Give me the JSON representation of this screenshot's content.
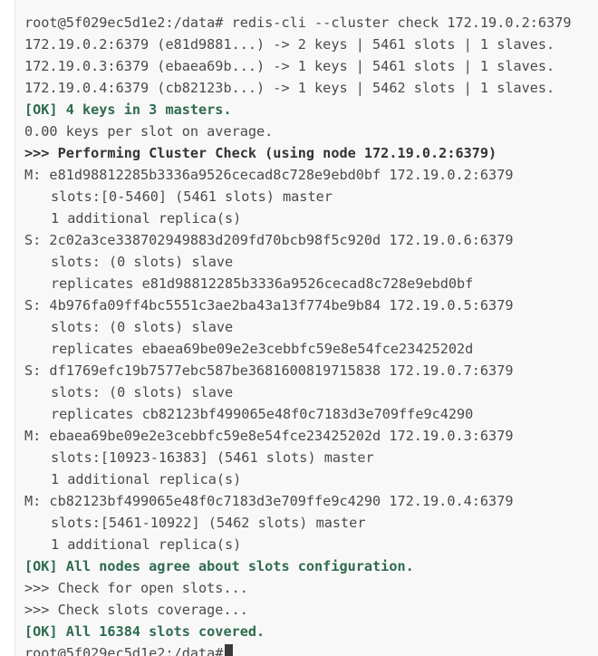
{
  "terminal": {
    "lines": [
      "root@5f029ec5d1e2:/data# redis-cli --cluster check 172.19.0.2:6379",
      "172.19.0.2:6379 (e81d9881...) -> 2 keys | 5461 slots | 1 slaves.",
      "172.19.0.3:6379 (ebaea69b...) -> 1 keys | 5461 slots | 1 slaves.",
      "172.19.0.4:6379 (cb82123b...) -> 1 keys | 5462 slots | 1 slaves.",
      "[OK] 4 keys in 3 masters.",
      "0.00 keys per slot on average.",
      ">>> Performing Cluster Check (using node 172.19.0.2:6379)",
      "M: e81d98812285b3336a9526cecad8c728e9ebd0bf 172.19.0.2:6379",
      "slots:[0-5460] (5461 slots) master",
      "1 additional replica(s)",
      "S: 2c02a3ce338702949883d209fd70bcb98f5c920d 172.19.0.6:6379",
      "slots: (0 slots) slave",
      "replicates e81d98812285b3336a9526cecad8c728e9ebd0bf",
      "S: 4b976fa09ff4bc5551c3ae2ba43a13f774be9b84 172.19.0.5:6379",
      "slots: (0 slots) slave",
      "replicates ebaea69be09e2e3cebbfc59e8e54fce23425202d",
      "S: df1769efc19b7577ebc587be3681600819715838 172.19.0.7:6379",
      "slots: (0 slots) slave",
      "replicates cb82123bf499065e48f0c7183d3e709ffe9c4290",
      "M: ebaea69be09e2e3cebbfc59e8e54fce23425202d 172.19.0.3:6379",
      "slots:[10923-16383] (5461 slots) master",
      "1 additional replica(s)",
      "M: cb82123bf499065e48f0c7183d3e709ffe9c4290 172.19.0.4:6379",
      "slots:[5461-10922] (5462 slots) master",
      "1 additional replica(s)",
      "[OK] All nodes agree about slots configuration.",
      ">>> Check for open slots...",
      ">>> Check slots coverage...",
      "[OK] All 16384 slots covered.",
      "root@5f029ec5d1e2:/data#"
    ]
  }
}
